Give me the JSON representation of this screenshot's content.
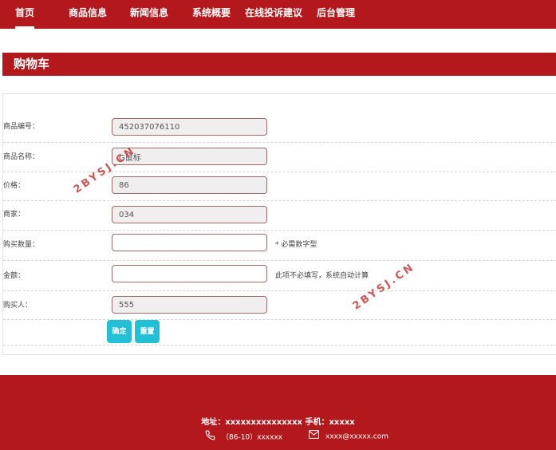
{
  "nav": {
    "items": [
      {
        "label": "首页"
      },
      {
        "label": "商品信息"
      },
      {
        "label": "新闻信息"
      },
      {
        "label": "系统概要"
      },
      {
        "label": "在线投诉建议"
      },
      {
        "label": "后台管理"
      }
    ]
  },
  "section": {
    "title": "购物车"
  },
  "form": {
    "product_no": {
      "label": "商品编号：",
      "value": "452037076110"
    },
    "product_name": {
      "label": "商品名称：",
      "value": "G鼠标"
    },
    "price": {
      "label": "价格：",
      "value": "86"
    },
    "merchant": {
      "label": "商家：",
      "value": "034"
    },
    "quantity": {
      "label": "购买数量：",
      "value": "",
      "hint": "* 必需数字型"
    },
    "amount": {
      "label": "金额：",
      "value": "",
      "hint": "此项不必填写，系统自动计算"
    },
    "buyer": {
      "label": "购买人：",
      "value": "555"
    },
    "confirm_label": "确定",
    "reset_label": "重置"
  },
  "watermark": {
    "text": "2BYSJ.CN"
  },
  "footer": {
    "address": "地址：xxxxxxxxxxxxxxx 手机：xxxxx",
    "phone": "（86-10）xxxxxx",
    "email": "xxxx@xxxxx.com"
  }
}
